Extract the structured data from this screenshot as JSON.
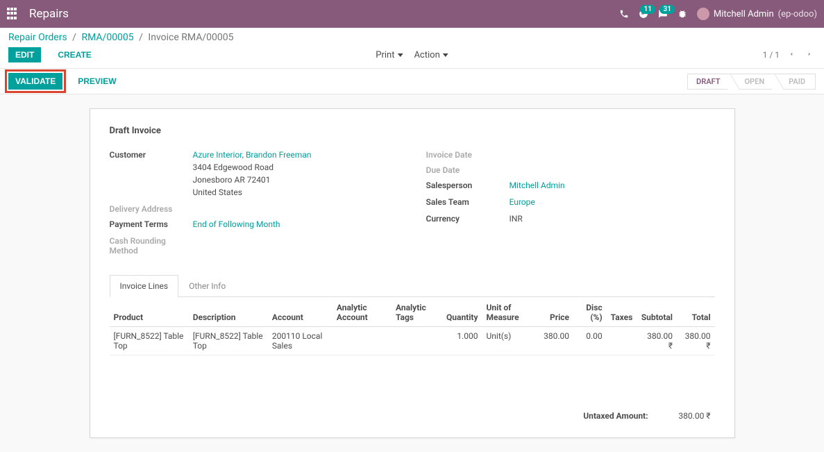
{
  "navbar": {
    "title": "Repairs",
    "clock_badge": "11",
    "chat_badge": "31",
    "user_name": "Mitchell Admin",
    "user_db": "(ep-odoo)"
  },
  "breadcrumb": {
    "root": "Repair Orders",
    "parent": "RMA/00005",
    "current": "Invoice RMA/00005"
  },
  "controls": {
    "edit": "EDIT",
    "create": "CREATE",
    "print": "Print",
    "action": "Action",
    "pager": "1 / 1"
  },
  "statusbar": {
    "validate": "VALIDATE",
    "preview": "PREVIEW",
    "stages": {
      "draft": "DRAFT",
      "open": "OPEN",
      "paid": "PAID"
    }
  },
  "form": {
    "title": "Draft Invoice",
    "labels": {
      "customer": "Customer",
      "delivery_address": "Delivery Address",
      "payment_terms": "Payment Terms",
      "cash_rounding": "Cash Rounding Method",
      "invoice_date": "Invoice Date",
      "due_date": "Due Date",
      "salesperson": "Salesperson",
      "sales_team": "Sales Team",
      "currency": "Currency"
    },
    "customer": {
      "name": "Azure Interior, Brandon Freeman",
      "line1": "3404 Edgewood Road",
      "line2": "Jonesboro AR 72401",
      "line3": "United States"
    },
    "payment_terms": "End of Following Month",
    "salesperson": "Mitchell Admin",
    "sales_team": "Europe",
    "currency": "INR"
  },
  "tabs": {
    "invoice_lines": "Invoice Lines",
    "other_info": "Other Info"
  },
  "table": {
    "headers": {
      "product": "Product",
      "description": "Description",
      "account": "Account",
      "analytic_account": "Analytic Account",
      "analytic_tags": "Analytic Tags",
      "quantity": "Quantity",
      "uom": "Unit of Measure",
      "price": "Price",
      "disc": "Disc (%)",
      "taxes": "Taxes",
      "subtotal": "Subtotal",
      "total": "Total"
    },
    "row": {
      "product": "[FURN_8522] Table Top",
      "description": "[FURN_8522] Table Top",
      "account": "200110 Local Sales",
      "quantity": "1.000",
      "uom": "Unit(s)",
      "price": "380.00",
      "disc": "0.00",
      "subtotal": "380.00 ₹",
      "total": "380.00 ₹"
    }
  },
  "totals": {
    "untaxed_label": "Untaxed Amount:",
    "untaxed_value": "380.00 ₹"
  }
}
